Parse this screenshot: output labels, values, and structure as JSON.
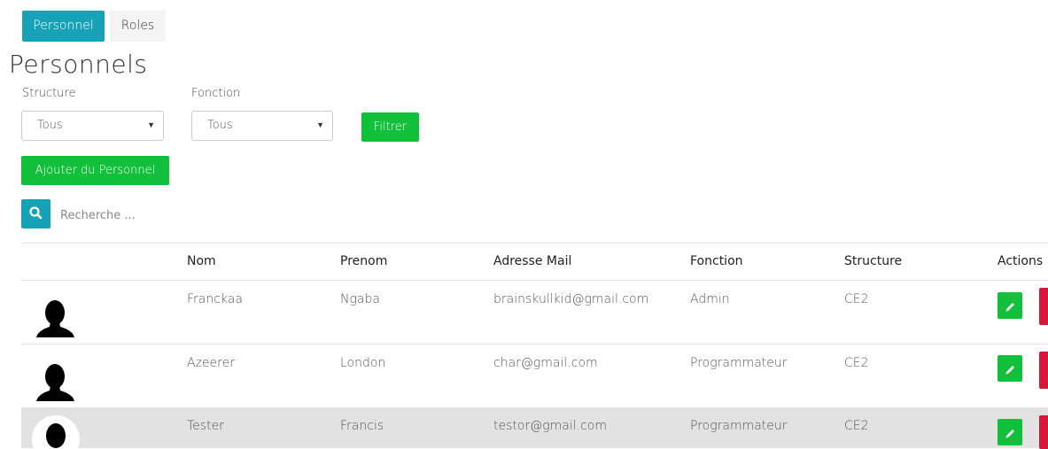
{
  "tabs": [
    {
      "label": "Personnel",
      "active": true
    },
    {
      "label": "Roles",
      "active": false
    }
  ],
  "page_title": "Personnels",
  "filters": {
    "structure": {
      "label": "Structure",
      "value": "Tous"
    },
    "fonction": {
      "label": "Fonction",
      "value": "Tous"
    },
    "filter_button": "Filtrer"
  },
  "add_button": "Ajouter du Personnel",
  "search": {
    "placeholder": "Recherche ...",
    "icon": "search-icon"
  },
  "table": {
    "headers": [
      "",
      "Nom",
      "Prenom",
      "Adresse Mail",
      "Fonction",
      "Structure",
      "Actions"
    ],
    "rows": [
      {
        "nom": "Franckaa",
        "prenom": "Ngaba",
        "email": "brainskullkid@gmail.com",
        "fonction": "Admin",
        "structure": "CE2"
      },
      {
        "nom": "Azeerer",
        "prenom": "London",
        "email": "char@gmail.com",
        "fonction": "Programmateur",
        "structure": "CE2"
      },
      {
        "nom": "Tester",
        "prenom": "Francis",
        "email": "testor@gmail.com",
        "fonction": "Programmateur",
        "structure": "CE2"
      }
    ]
  },
  "colors": {
    "primary": "#17a2b8",
    "success": "#12c03c",
    "danger": "#d9163a",
    "row_highlight": "#e2e2e2"
  }
}
